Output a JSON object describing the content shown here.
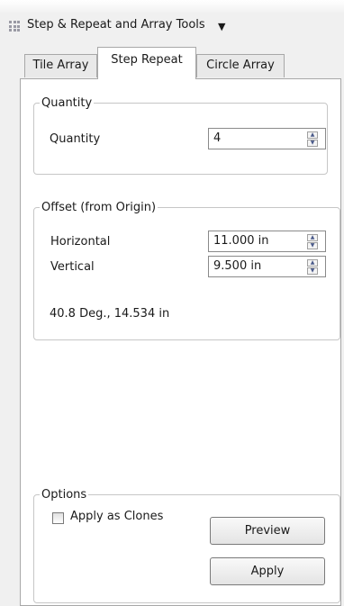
{
  "window": {
    "title": "Step & Repeat and Array Tools",
    "title_dropdown_icon": "caret-down",
    "grip_icon": "grid-dots"
  },
  "tabs": [
    {
      "label": "Tile Array",
      "active": false
    },
    {
      "label": "Step Repeat",
      "active": true
    },
    {
      "label": "Circle Array",
      "active": false
    }
  ],
  "quantity_group": {
    "legend": "Quantity",
    "label": "Quantity",
    "value": "4"
  },
  "offset_group": {
    "legend": "Offset (from Origin)",
    "horizontal_label": "Horizontal",
    "horizontal_value": "11.000 in",
    "vertical_label": "Vertical",
    "vertical_value": "9.500 in",
    "summary": "40.8 Deg., 14.534 in"
  },
  "options_group": {
    "legend": "Options",
    "apply_as_clones_label": "Apply as Clones",
    "apply_as_clones_checked": false,
    "preview_label": "Preview",
    "apply_label": "Apply"
  },
  "icons": {
    "spinner_up": "▲",
    "spinner_down": "▼"
  }
}
